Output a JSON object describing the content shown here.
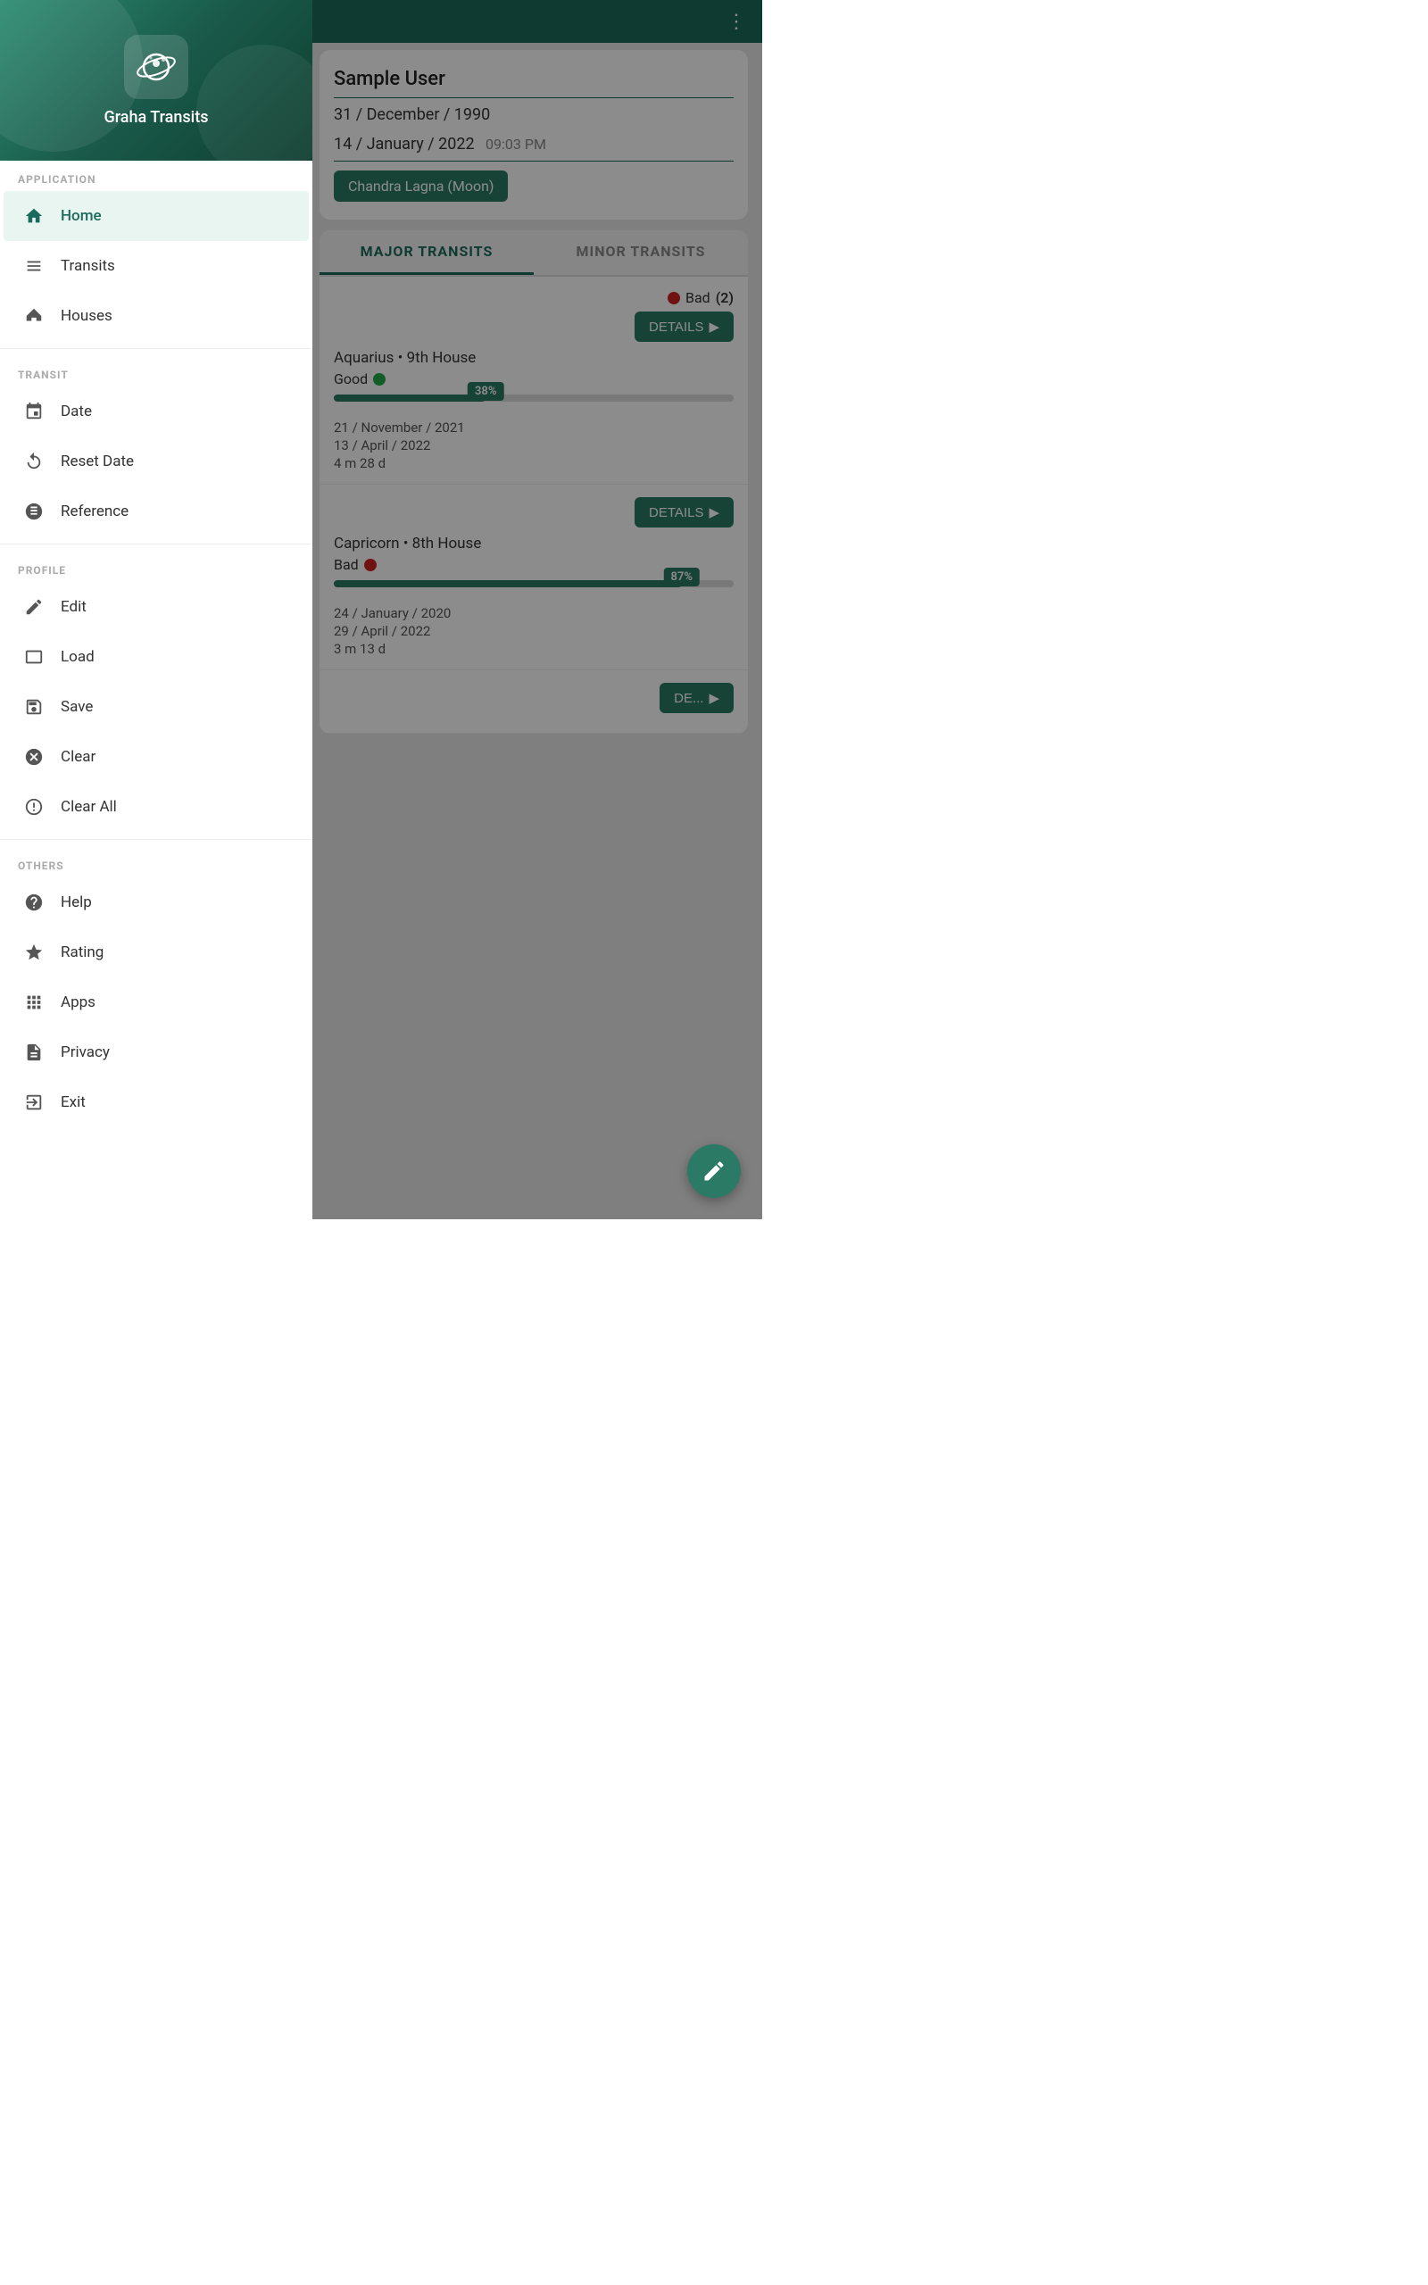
{
  "app": {
    "title": "Graha Transits",
    "icon_label": "planet-icon"
  },
  "topbar": {
    "menu_dots": "⋮"
  },
  "profile": {
    "name": "Sample User",
    "dob": "31 / December / 1990",
    "transit_date": "14 / January / 2022",
    "transit_time": "09:03 PM",
    "lagna": "Chandra  Lagna (Moon)"
  },
  "tabs": {
    "major": "MAJOR TRANSITS",
    "minor": "MINOR TRANSITS"
  },
  "transit1": {
    "status": "Bad",
    "count": "(2)",
    "details_btn": "DETAILS",
    "location": "Aquarius • 9th House",
    "quality": "Good",
    "progress": 38,
    "progress_label": "38%",
    "start_date": "21 / November / 2021",
    "end_date": "13 / April / 2022",
    "duration": "4 m  28 d"
  },
  "transit2": {
    "details_btn": "DETAILS",
    "location": "Capricorn • 8th House",
    "quality": "Bad",
    "progress": 87,
    "progress_label": "87%",
    "start_date": "24 / January / 2020",
    "end_date": "29 / April / 2022",
    "duration": "3 m  13 d"
  },
  "transit3": {
    "details_btn": "DE..."
  },
  "drawer": {
    "sections": {
      "application": "APPLICATION",
      "transit": "TRANSIT",
      "profile": "PROFILE",
      "others": "OTHERS"
    },
    "items": {
      "home": "Home",
      "transits": "Transits",
      "houses": "Houses",
      "date": "Date",
      "reset_date": "Reset Date",
      "reference": "Reference",
      "edit": "Edit",
      "load": "Load",
      "save": "Save",
      "clear": "Clear",
      "clear_all": "Clear All",
      "help": "Help",
      "rating": "Rating",
      "apps": "Apps",
      "privacy": "Privacy",
      "exit": "Exit"
    }
  }
}
